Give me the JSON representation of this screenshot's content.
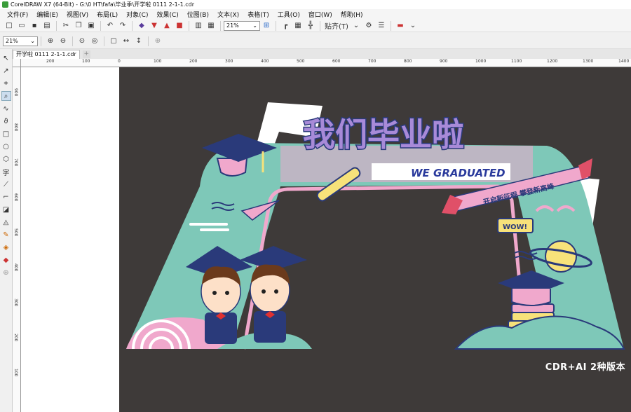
{
  "window": {
    "title": "CorelDRAW X7 (64-Bit) - G:\\0 HT\\fafa\\毕业季\\开学啦 0111 2-1-1.cdr"
  },
  "menu": [
    "文件(F)",
    "编辑(E)",
    "视图(V)",
    "布局(L)",
    "对象(C)",
    "效果(C)",
    "位图(B)",
    "文本(X)",
    "表格(T)",
    "工具(O)",
    "窗口(W)",
    "帮助(H)"
  ],
  "toolbar": {
    "zoom_value": "21%",
    "snap_label": "贴齐(T)"
  },
  "propertybar": {
    "zoom_value": "21%"
  },
  "document": {
    "tab_name": "开学啦 0111 2-1-1.cdr"
  },
  "ruler": {
    "h_ticks": [
      "200",
      "100",
      "0",
      "100",
      "200",
      "300",
      "400",
      "500",
      "600",
      "700",
      "800",
      "900",
      "1000",
      "1100",
      "1200",
      "1300",
      "1400"
    ],
    "v_ticks": [
      "900",
      "800",
      "700",
      "600",
      "500",
      "400",
      "300",
      "200",
      "100"
    ]
  },
  "artwork": {
    "title_cn": "我们毕业啦",
    "title_en": "WE GRADUATED",
    "ribbon_text": "开启新征程 攀登新高峰",
    "wow_text": "WOW!"
  },
  "watermark": "CDR+AI 2种版本",
  "colors": {
    "canvas": "#3e3a39",
    "teal": "#7ec8b8",
    "pink": "#f0a8cc",
    "navy": "#2a3a7a",
    "purple": "#5a3c9c",
    "yellow": "#f7e27a"
  }
}
